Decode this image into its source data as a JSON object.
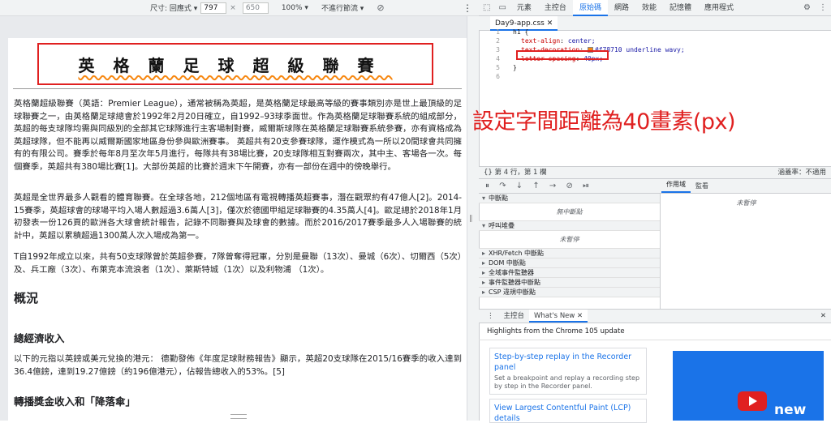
{
  "device_toolbar": {
    "size_label": "尺寸: 回應式 ▾",
    "width": "797",
    "times": "×",
    "height": "650",
    "zoom": "100% ▾",
    "throttle": "不進行節流 ▾",
    "menu_glyph": "⋮"
  },
  "page": {
    "title": "英格蘭足球超級聯賽",
    "p1": "英格蘭超級聯賽（英語：Premier League），通常被稱為英超，是英格蘭足球最高等級的賽事類別亦是世上最頂級的足球聯賽之一，由英格蘭足球總會於1992年2月20日確立，自1992–93球季面世。作為英格蘭足球聯賽系統的組成部分，英超的每支球隊均需與同級別的全部其它球隊進行主客場制對賽，威爾斯球隊在英格蘭足球聯賽系統參賽，亦有資格成為英超球隊，但不能再以威爾斯國家地區身份參與歐洲賽事。 英超共有20支參賽球隊，運作模式為一所以20間球會共同擁有的有限公司。賽季於每年8月至次年5月進行，每隊共有38場比賽，20支球隊相互對賽兩次，其中主、客場各一次。每個賽季，英超共有380場比賽[1]。大部份英超的比賽於週末下午開賽，亦有一部份在週中的傍晚舉行。",
    "p2": "英超是全世界最多人觀看的體育聯賽。在全球各地，212個地區有電視轉播英超賽事，潛在觀眾約有47億人[2]。2014-15賽季，英超球會的球場平均入場人數超過3.6萬人[3]，僅次於德國甲組足球聯賽的4.35萬人[4]。歐足總於2018年1月初發表一份126頁的歐洲各大球會統計報告，記錄不同聯賽與及球會的數據。而於2016/2017賽季最多人入場聯賽的統計中，英超以累積超過1300萬人次入場成為第一。",
    "p3": "T自1992年成立以來，共有50支球隊曾於英超參賽，7隊曾奪得冠軍，分別是曼聯（13次）、曼城（6次）、切爾西（5次）及、兵工廠（3次）、布萊克本流浪者（1次）、萊斯特城（1次）以及利物浦 （1次）。",
    "h_overview": "概況",
    "h_revenue": "總經濟收入",
    "p4": "以下的元指以英鎊或美元兌換的港元： 德勤發佈《年度足球財務報告》顯示，英超20支球隊在2015/16賽季的收入達到36.4億鎊，達到19.27億鎊（約196億港元），佔報告總收入的53%。[5]",
    "h_broadcast": "轉播獎金收入和「降落傘」"
  },
  "devtools": {
    "tabs": [
      "元素",
      "主控台",
      "原始碼",
      "網路",
      "效能",
      "記憶體",
      "應用程式"
    ],
    "active_tab": "原始碼",
    "file_tab": "Day9-app.css ✕",
    "code": [
      {
        "n": "1",
        "text": "h1 {"
      },
      {
        "n": "2",
        "prop": "text-align",
        "val": "center;"
      },
      {
        "n": "3",
        "prop": "text-decoration",
        "val": "#f78710 underline wavy;"
      },
      {
        "n": "4",
        "prop": "letter-spacing",
        "val": "40px;"
      },
      {
        "n": "5",
        "text": "}"
      },
      {
        "n": "6",
        "text": ""
      }
    ],
    "status_left": "{}   第 4 行，第 1 欄",
    "status_right": "涵蓋率：不適用",
    "sections": [
      {
        "label": "中斷點",
        "open": true,
        "empty": "無中斷點"
      },
      {
        "label": "呼叫堆疊",
        "open": true,
        "empty": "未暫停"
      },
      {
        "label": "XHR/Fetch 中斷點",
        "open": false
      },
      {
        "label": "DOM 中斷點",
        "open": false
      },
      {
        "label": "全域事件監聽器",
        "open": false
      },
      {
        "label": "事件監聽器中斷點",
        "open": false
      },
      {
        "label": "CSP 違規中斷點",
        "open": false
      }
    ],
    "right_tabs": [
      "作用域",
      "監看"
    ],
    "right_empty": "未暫停",
    "drawer_tabs": [
      "主控台",
      "What's New ✕"
    ],
    "highlights": "Highlights from the Chrome 105 update",
    "cards": [
      {
        "title": "Step-by-step replay in the Recorder panel",
        "desc": "Set a breakpoint and replay a recording step by step in the Recorder panel."
      },
      {
        "title": "View Largest Contentful Paint (LCP) details",
        "desc": ""
      }
    ],
    "video_label": "new"
  },
  "annotation": "設定字間距離為40畫素(px)",
  "colors": {
    "accent": "#1a73e8",
    "highlight": "#e02020",
    "wavy": "#f78710"
  }
}
